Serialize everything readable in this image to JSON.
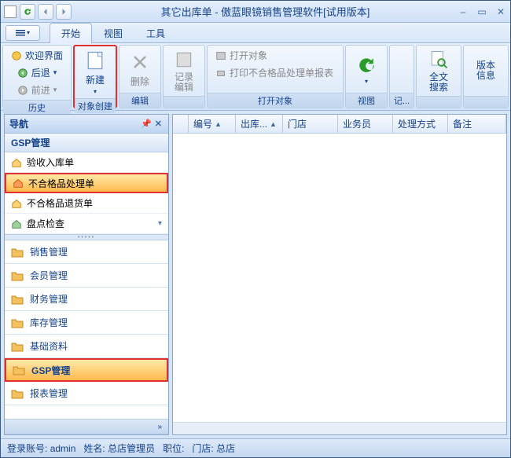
{
  "window": {
    "title": "其它出库单 - 傲蓝眼镜销售管理软件[试用版本]"
  },
  "tabs": {
    "start": "开始",
    "view": "视图",
    "tools": "工具"
  },
  "ribbon": {
    "history": {
      "welcome": "欢迎界面",
      "back": "后退",
      "forward": "前进",
      "label": "历史"
    },
    "create": {
      "new": "新建",
      "label": "对象创建"
    },
    "edit": {
      "delete": "删除",
      "label": "编辑"
    },
    "record": {
      "edit_record": "记录编辑"
    },
    "open": {
      "open_obj": "打开对象",
      "print_report": "打印不合格品处理单报表",
      "label": "打开对象"
    },
    "view2": {
      "label": "视图"
    },
    "records": {
      "label": "记..."
    },
    "search": {
      "fulltext": "全文搜索"
    },
    "version": {
      "info": "版本信息"
    }
  },
  "nav": {
    "title": "导航",
    "section": "GSP管理",
    "tree": [
      {
        "label": "验收入库单"
      },
      {
        "label": "不合格品处理单"
      },
      {
        "label": "不合格品退货单"
      },
      {
        "label": "盘点检查"
      }
    ],
    "cats": [
      {
        "label": "销售管理"
      },
      {
        "label": "会员管理"
      },
      {
        "label": "财务管理"
      },
      {
        "label": "库存管理"
      },
      {
        "label": "基础资料"
      },
      {
        "label": "GSP管理"
      },
      {
        "label": "报表管理"
      }
    ]
  },
  "grid": {
    "cols": [
      "编号",
      "出库...",
      "门店",
      "业务员",
      "处理方式",
      "备注"
    ]
  },
  "status": {
    "account_lbl": "登录账号:",
    "account": "admin",
    "name_lbl": "姓名:",
    "name": "总店管理员",
    "role_lbl": "职位:",
    "store_lbl": "门店:",
    "store": "总店"
  }
}
